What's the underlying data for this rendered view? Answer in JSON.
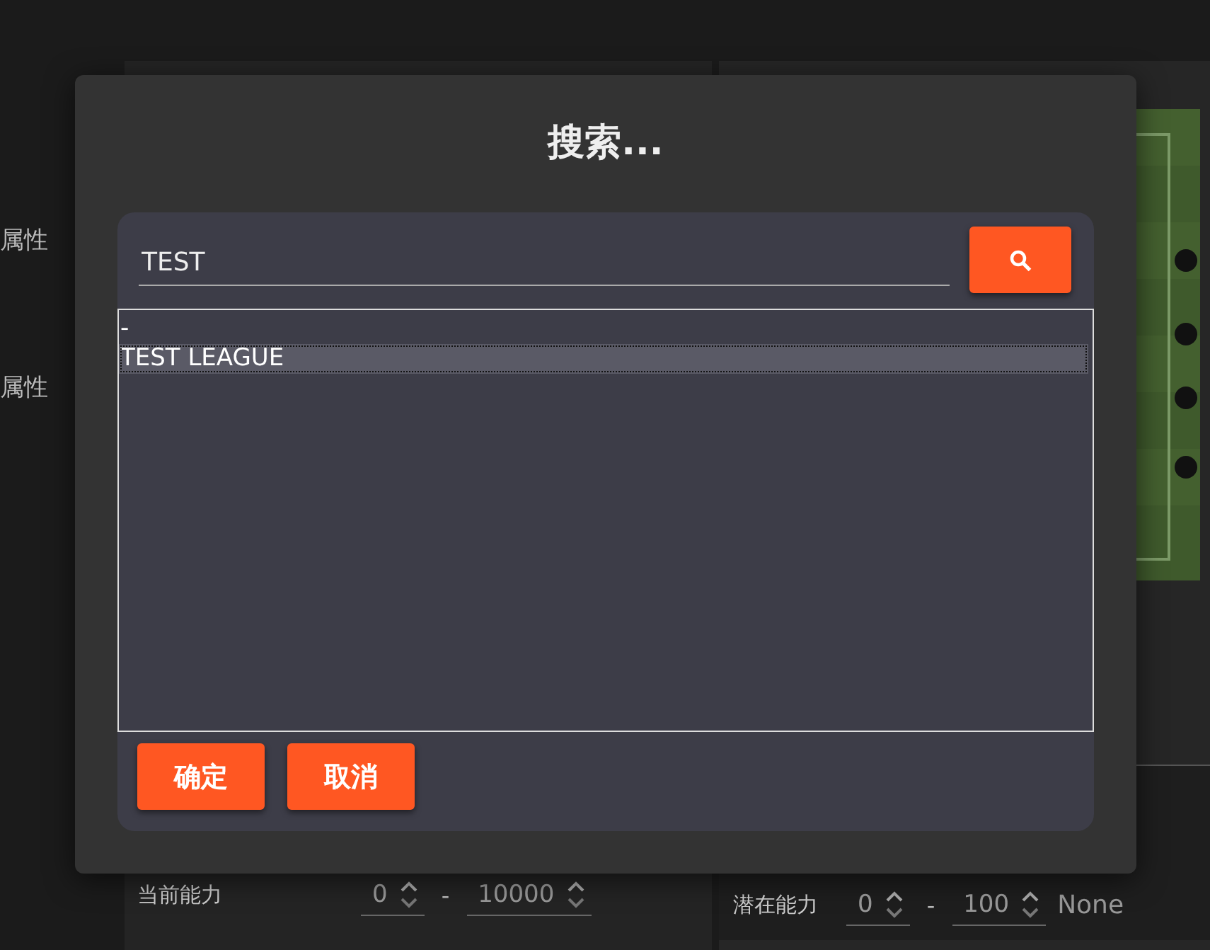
{
  "sidebar": {
    "labels": [
      "属性",
      "属性"
    ]
  },
  "left_panel": {
    "rows": [
      {
        "label": "当前能力",
        "min": "0",
        "separator": "-",
        "max": "10000"
      }
    ]
  },
  "right_panel": {
    "rows": [
      {
        "label": "潜在能力",
        "min": "0",
        "separator": "-",
        "max": "100",
        "extra": "None"
      }
    ]
  },
  "dialog": {
    "title": "搜索...",
    "search": {
      "value": "TEST"
    },
    "results": [
      {
        "text": "-",
        "selected": false
      },
      {
        "text": "TEST LEAGUE",
        "selected": true
      }
    ],
    "buttons": [
      "确定",
      "取消"
    ]
  }
}
